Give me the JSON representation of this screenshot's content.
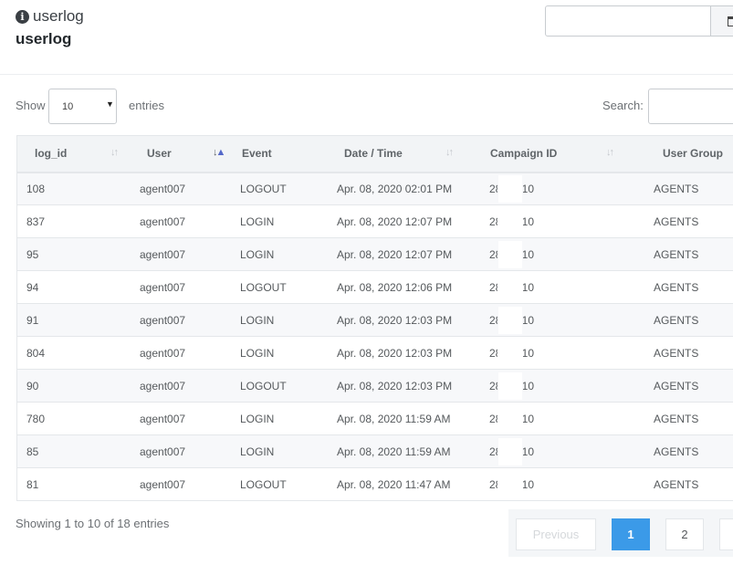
{
  "header": {
    "title": "userlog",
    "subtitle": "userlog",
    "date_value": ""
  },
  "controls": {
    "show_label": "Show",
    "length_value": "10",
    "entries_label": "entries",
    "search_label": "Search:",
    "search_value": ""
  },
  "table": {
    "headers": [
      "log_id",
      "User",
      "Event",
      "Date / Time",
      "Campaign ID",
      "User Group"
    ],
    "rows": [
      [
        "108",
        "agent007",
        "LOGOUT",
        "Apr. 08, 2020 02:01 PM",
        "28",
        "10",
        "AGENTS"
      ],
      [
        "837",
        "agent007",
        "LOGIN",
        "Apr. 08, 2020 12:07 PM",
        "28",
        "10",
        "AGENTS"
      ],
      [
        "95",
        "agent007",
        "LOGIN",
        "Apr. 08, 2020 12:07 PM",
        "28",
        "10",
        "AGENTS"
      ],
      [
        "94",
        "agent007",
        "LOGOUT",
        "Apr. 08, 2020 12:06 PM",
        "28",
        "10",
        "AGENTS"
      ],
      [
        "91",
        "agent007",
        "LOGIN",
        "Apr. 08, 2020 12:03 PM",
        "28",
        "10",
        "AGENTS"
      ],
      [
        "804",
        "agent007",
        "LOGIN",
        "Apr. 08, 2020 12:03 PM",
        "28",
        "10",
        "AGENTS"
      ],
      [
        "90",
        "agent007",
        "LOGOUT",
        "Apr. 08, 2020 12:03 PM",
        "28",
        "10",
        "AGENTS"
      ],
      [
        "780",
        "agent007",
        "LOGIN",
        "Apr. 08, 2020 11:59 AM",
        "28",
        "10",
        "AGENTS"
      ],
      [
        "85",
        "agent007",
        "LOGIN",
        "Apr. 08, 2020 11:59 AM",
        "28",
        "10",
        "AGENTS"
      ],
      [
        "81",
        "agent007",
        "LOGOUT",
        "Apr. 08, 2020 11:47 AM",
        "28",
        "10",
        "AGENTS"
      ]
    ]
  },
  "footer": {
    "info": "Showing 1 to 10 of 18 entries",
    "previous_label": "Previous",
    "pages": [
      "1",
      "2"
    ],
    "current_page": "1"
  },
  "icons": {
    "title_icon": "info-circle-icon",
    "date_addon_icon": "calendar-icon",
    "sort_icon": "sort-arrows-icon"
  },
  "colors": {
    "accent": "#3b9ae8",
    "sort_active": "#5468c9"
  }
}
